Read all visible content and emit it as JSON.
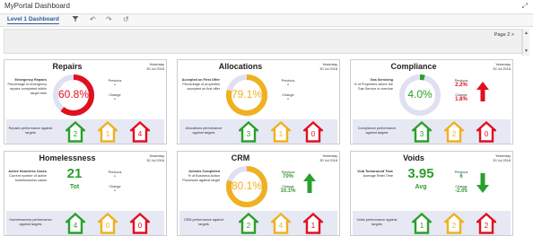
{
  "window": {
    "title": "MyPortal Dashboard"
  },
  "toolbar": {
    "tab_label": "Level 1 Dashboard"
  },
  "page_nav": {
    "label": "Page 2 >"
  },
  "colors": {
    "green": "#2aa02a",
    "amber": "#f0b020",
    "red": "#e01020",
    "track": "#dfe1f2",
    "bottom_bg": "#e6e8f4"
  },
  "panels": [
    {
      "title": "Repairs",
      "date_label": "Yesterday",
      "date_value": "30 Jul 2018",
      "metric_name": "Emergency Repairs",
      "metric_desc": "Percentage of emergency repairs completed within target time",
      "display": "60.8%",
      "gauge_percent": 60.8,
      "gauge_color": "red",
      "previous_label": "Previous",
      "previous_value": "-",
      "change_label": "Change",
      "change_value": "-",
      "arrow": "none",
      "bottom_label": "Repairs performance against targets",
      "counts": [
        "2",
        "1",
        "4"
      ]
    },
    {
      "title": "Allocations",
      "date_label": "Yesterday",
      "date_value": "30 Jul 2018",
      "metric_name": "Accepted on First Offer",
      "metric_desc": "Percentage of properties accepted on first offer",
      "display": "79.1%",
      "gauge_percent": 79.1,
      "gauge_color": "amber",
      "previous_label": "Previous",
      "previous_value": "-",
      "change_label": "Change",
      "change_value": "-",
      "arrow": "none",
      "bottom_label": "Allocations performance against targets",
      "counts": [
        "3",
        "1",
        "0"
      ]
    },
    {
      "title": "Compliance",
      "date_label": "Yesterday",
      "date_value": "30 Jul 2018",
      "metric_name": "Gas Servicing",
      "metric_desc": "% of Properties where the Gas Service is overdue",
      "display": "4.0%",
      "gauge_percent": 4.0,
      "gauge_color": "green",
      "previous_label": "Previous",
      "previous_value": "2.2%",
      "change_label": "Change",
      "change_value": "1.8%",
      "arrow": "up-red",
      "bottom_label": "Compliance performance against targets",
      "counts": [
        "3",
        "2",
        "0"
      ]
    },
    {
      "title": "Homelessness",
      "date_label": "Yesterday",
      "date_value": "30 Jul 2018",
      "metric_name": "Active Homeless Cases",
      "metric_desc": "Current number of active homelessness cases",
      "big_value": "21",
      "big_sub": "Tot",
      "previous_label": "Previous",
      "previous_value": "-",
      "change_label": "Change",
      "change_value": "-",
      "arrow": "none",
      "bottom_label": "Homelessness performance against targets",
      "counts": [
        "4",
        "0",
        "0"
      ]
    },
    {
      "title": "CRM",
      "date_label": "Yesterday",
      "date_value": "30 Jul 2018",
      "metric_name": "Actions Completed",
      "metric_desc": "% of Business Action Processes against target",
      "display": "80.1%",
      "gauge_percent": 80.1,
      "gauge_color": "amber",
      "previous_label": "Previous",
      "previous_value": "70%",
      "change_label": "Change",
      "change_value": "10.1%",
      "arrow": "up-green",
      "bottom_label": "CRM performance against targets",
      "counts": [
        "2",
        "4",
        "1"
      ]
    },
    {
      "title": "Voids",
      "date_label": "Yesterday",
      "date_value": "30 Jul 2018",
      "metric_name": "Void Turnaround Time",
      "metric_desc": "Average Relet Time",
      "big_value": "3.95",
      "big_sub": "Avg",
      "previous_label": "Previous",
      "previous_value": "6",
      "change_label": "Change",
      "change_value": "-2.05",
      "arrow": "down-green",
      "bottom_label": "Voids performance against targets",
      "counts": [
        "1",
        "2",
        "2"
      ]
    }
  ]
}
